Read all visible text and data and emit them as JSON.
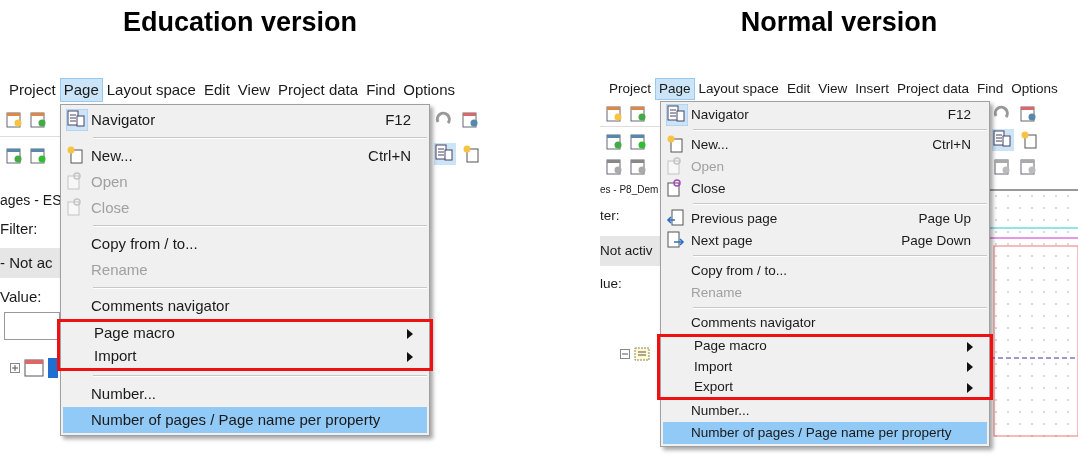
{
  "panels": [
    {
      "heading": "Education version",
      "menubar": [
        {
          "label": "Project",
          "selected": false
        },
        {
          "label": "Page",
          "selected": true
        },
        {
          "label": "Layout space",
          "selected": false
        },
        {
          "label": "Edit",
          "selected": false
        },
        {
          "label": "View",
          "selected": false
        },
        {
          "label": "Project data",
          "selected": false
        },
        {
          "label": "Find",
          "selected": false
        },
        {
          "label": "Options",
          "selected": false
        }
      ],
      "side_labels": [
        "ages - ES",
        "Filter:",
        "- Not ac",
        "Value:"
      ],
      "menu": [
        {
          "kind": "item",
          "label": "Navigator",
          "shortcut": "F12",
          "disabled": false,
          "selected": false,
          "submenu": false,
          "boxed": false
        },
        {
          "kind": "separator"
        },
        {
          "kind": "item",
          "label": "New...",
          "shortcut": "Ctrl+N",
          "disabled": false,
          "selected": false,
          "submenu": false,
          "boxed": false
        },
        {
          "kind": "item",
          "label": "Open",
          "disabled": true,
          "selected": false,
          "submenu": false,
          "boxed": false
        },
        {
          "kind": "item",
          "label": "Close",
          "disabled": true,
          "selected": false,
          "submenu": false,
          "boxed": false
        },
        {
          "kind": "separator"
        },
        {
          "kind": "item",
          "label": "Copy from / to...",
          "disabled": false,
          "selected": false,
          "submenu": false,
          "boxed": false
        },
        {
          "kind": "item",
          "label": "Rename",
          "disabled": true,
          "selected": false,
          "submenu": false,
          "boxed": false
        },
        {
          "kind": "separator"
        },
        {
          "kind": "item",
          "label": "Comments navigator",
          "disabled": false,
          "selected": false,
          "submenu": false,
          "boxed": false
        },
        {
          "kind": "item",
          "label": "Page macro",
          "disabled": false,
          "selected": false,
          "submenu": true,
          "boxed": true
        },
        {
          "kind": "item",
          "label": "Import",
          "disabled": false,
          "selected": false,
          "submenu": true,
          "boxed": true
        },
        {
          "kind": "separator"
        },
        {
          "kind": "item",
          "label": "Number...",
          "disabled": false,
          "selected": false,
          "submenu": false,
          "boxed": false
        },
        {
          "kind": "item",
          "label": "Number of pages / Page name per property",
          "disabled": false,
          "selected": true,
          "submenu": false,
          "boxed": false
        }
      ]
    },
    {
      "heading": "Normal version",
      "menubar": [
        {
          "label": "Project",
          "selected": false
        },
        {
          "label": "Page",
          "selected": true
        },
        {
          "label": "Layout space",
          "selected": false
        },
        {
          "label": "Edit",
          "selected": false
        },
        {
          "label": "View",
          "selected": false
        },
        {
          "label": "Insert",
          "selected": false
        },
        {
          "label": "Project data",
          "selected": false
        },
        {
          "label": "Find",
          "selected": false
        },
        {
          "label": "Options",
          "selected": false
        }
      ],
      "side_labels": [
        "es - P8_Dem",
        "ter:",
        "Not activ",
        "lue:"
      ],
      "menu": [
        {
          "kind": "item",
          "label": "Navigator",
          "shortcut": "F12",
          "disabled": false,
          "selected": false,
          "submenu": false,
          "boxed": false
        },
        {
          "kind": "separator"
        },
        {
          "kind": "item",
          "label": "New...",
          "shortcut": "Ctrl+N",
          "disabled": false,
          "selected": false,
          "submenu": false,
          "boxed": false
        },
        {
          "kind": "item",
          "label": "Open",
          "disabled": true,
          "selected": false,
          "submenu": false,
          "boxed": false
        },
        {
          "kind": "item",
          "label": "Close",
          "disabled": false,
          "selected": false,
          "submenu": false,
          "boxed": false
        },
        {
          "kind": "separator"
        },
        {
          "kind": "item",
          "label": "Previous page",
          "shortcut": "Page Up",
          "disabled": false,
          "selected": false,
          "submenu": false,
          "boxed": false
        },
        {
          "kind": "item",
          "label": "Next page",
          "shortcut": "Page Down",
          "disabled": false,
          "selected": false,
          "submenu": false,
          "boxed": false
        },
        {
          "kind": "separator"
        },
        {
          "kind": "item",
          "label": "Copy from / to...",
          "disabled": false,
          "selected": false,
          "submenu": false,
          "boxed": false
        },
        {
          "kind": "item",
          "label": "Rename",
          "disabled": true,
          "selected": false,
          "submenu": false,
          "boxed": false
        },
        {
          "kind": "separator"
        },
        {
          "kind": "item",
          "label": "Comments navigator",
          "disabled": false,
          "selected": false,
          "submenu": false,
          "boxed": false
        },
        {
          "kind": "item",
          "label": "Page macro",
          "disabled": false,
          "selected": false,
          "submenu": true,
          "boxed": true
        },
        {
          "kind": "item",
          "label": "Import",
          "disabled": false,
          "selected": false,
          "submenu": true,
          "boxed": true
        },
        {
          "kind": "item",
          "label": "Export",
          "disabled": false,
          "selected": false,
          "submenu": true,
          "boxed": true
        },
        {
          "kind": "item",
          "label": "Number...",
          "disabled": false,
          "selected": false,
          "submenu": false,
          "boxed": false
        },
        {
          "kind": "item",
          "label": "Number of pages / Page name per property",
          "disabled": false,
          "selected": true,
          "submenu": false,
          "boxed": false
        }
      ]
    }
  ]
}
